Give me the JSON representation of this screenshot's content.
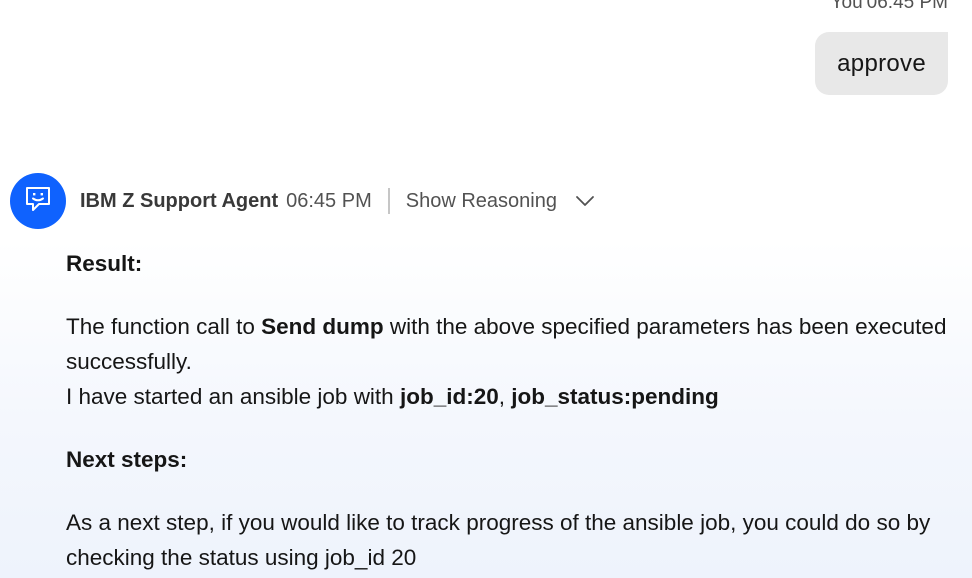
{
  "user_message": {
    "sender": "You",
    "time": "06:45 PM",
    "text": "approve"
  },
  "agent_message": {
    "avatar_icon": "chat-bot-icon",
    "avatar_color": "#0f62fe",
    "agent_name": "IBM Z Support Agent",
    "time": "06:45 PM",
    "reasoning_toggle_label": "Show Reasoning",
    "reasoning_toggle_icon": "chevron-down-icon",
    "result_heading": "Result:",
    "result_line1_prefix": "The function call to ",
    "result_line1_bold": "Send dump",
    "result_line1_suffix": " with the above specified parameters has been executed successfully.",
    "result_line2_prefix": "I have started an ansible job with ",
    "result_line2_job_id": "job_id:20",
    "result_line2_separator": ", ",
    "result_line2_job_status": "job_status:pending",
    "next_steps_heading": "Next steps:",
    "next_steps_text": "As a next step, if you would like to track progress of the ansible job, you could do so by checking the status using job_id 20"
  }
}
